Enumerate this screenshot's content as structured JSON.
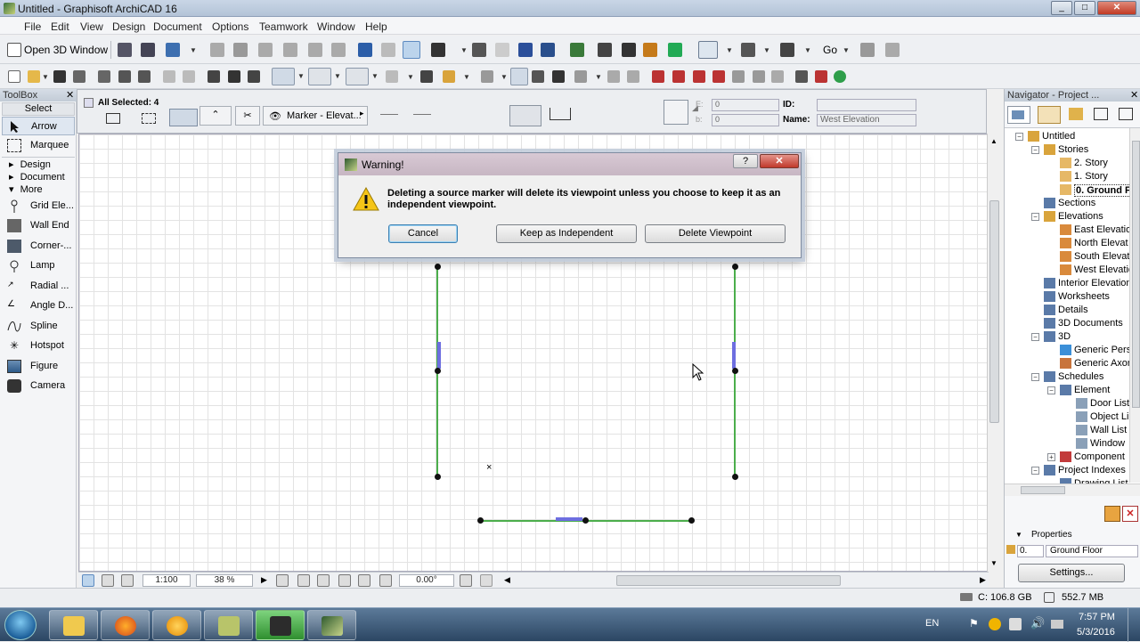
{
  "window": {
    "title": "Untitled - Graphisoft ArchiCAD 16",
    "min": "_",
    "max": "□",
    "close": "✕"
  },
  "menu": [
    "File",
    "Edit",
    "View",
    "Design",
    "Document",
    "Options",
    "Teamwork",
    "Window",
    "Help"
  ],
  "toolbar1": {
    "open3d": "Open 3D Window",
    "go": "Go"
  },
  "toolbox": {
    "title": "ToolBox",
    "close": "✕",
    "select": "Select",
    "groups": [
      "Design",
      "Document",
      "More"
    ],
    "tools": [
      {
        "label": "Arrow",
        "icon": "arrow-icon"
      },
      {
        "label": "Marquee",
        "icon": "marquee-icon"
      }
    ],
    "more_tools": [
      {
        "label": "Grid Ele...",
        "icon": "grid-element-icon"
      },
      {
        "label": "Wall End",
        "icon": "wall-end-icon"
      },
      {
        "label": "Corner-...",
        "icon": "corner-window-icon"
      },
      {
        "label": "Lamp",
        "icon": "lamp-icon"
      },
      {
        "label": "Radial ...",
        "icon": "radial-dimension-icon"
      },
      {
        "label": "Angle D...",
        "icon": "angle-dimension-icon"
      },
      {
        "label": "Spline",
        "icon": "spline-icon"
      },
      {
        "label": "Hotspot",
        "icon": "hotspot-icon"
      },
      {
        "label": "Figure",
        "icon": "figure-icon"
      },
      {
        "label": "Camera",
        "icon": "camera-icon"
      }
    ]
  },
  "infobox": {
    "selected": "All Selected: 4",
    "marker": "Marker - Elevat...",
    "e_label": "E:",
    "e_value": "0",
    "b_label": "b:",
    "b_value": "0",
    "id_label": "ID:",
    "id_value": "",
    "name_label": "Name:",
    "name_value": "West Elevation"
  },
  "dialog": {
    "title": "Warning!",
    "help": "?",
    "close": "✕",
    "message": "Deleting a source marker will delete its viewpoint unless you choose to keep it as an independent viewpoint.",
    "buttons": {
      "cancel": "Cancel",
      "keep": "Keep as Independent",
      "delete": "Delete Viewpoint"
    }
  },
  "statusbar": {
    "scale": "1:100",
    "zoom": "38 %",
    "angle": "0.00°"
  },
  "navigator": {
    "title": "Navigator - Project ...",
    "close": "✕",
    "tree": [
      {
        "label": "Untitled",
        "level": 0,
        "exp": "-"
      },
      {
        "label": "Stories",
        "level": 1,
        "exp": "-"
      },
      {
        "label": "2. Story",
        "level": 2
      },
      {
        "label": "1. Story",
        "level": 2
      },
      {
        "label": "0. Ground F",
        "level": 2,
        "selected": true
      },
      {
        "label": "Sections",
        "level": 1
      },
      {
        "label": "Elevations",
        "level": 1,
        "exp": "-"
      },
      {
        "label": "East Elevatio",
        "level": 2
      },
      {
        "label": "North Elevat",
        "level": 2
      },
      {
        "label": "South Elevat",
        "level": 2
      },
      {
        "label": "West Elevatio",
        "level": 2
      },
      {
        "label": "Interior Elevation",
        "level": 1
      },
      {
        "label": "Worksheets",
        "level": 1
      },
      {
        "label": "Details",
        "level": 1
      },
      {
        "label": "3D Documents",
        "level": 1
      },
      {
        "label": "3D",
        "level": 1,
        "exp": "-"
      },
      {
        "label": "Generic Pers",
        "level": 2
      },
      {
        "label": "Generic Axor",
        "level": 2
      },
      {
        "label": "Schedules",
        "level": 1,
        "exp": "-"
      },
      {
        "label": "Element",
        "level": 2,
        "exp": "-"
      },
      {
        "label": "Door List",
        "level": 3
      },
      {
        "label": "Object Li",
        "level": 3
      },
      {
        "label": "Wall List",
        "level": 3
      },
      {
        "label": "Window",
        "level": 3
      },
      {
        "label": "Component",
        "level": 2,
        "exp": "+"
      },
      {
        "label": "Project Indexes",
        "level": 1,
        "exp": "-"
      },
      {
        "label": "Drawing List",
        "level": 2
      }
    ],
    "properties_label": "Properties",
    "prop_num": "0.",
    "prop_value": "Ground Floor",
    "settings": "Settings..."
  },
  "bottom": {
    "disk": "C: 106.8 GB",
    "memory": "552.7 MB"
  },
  "taskbar": {
    "lang": "EN",
    "time": "7:57 PM",
    "date": "5/3/2016",
    "apps": [
      "start-orb",
      "explorer-icon",
      "firefox-icon",
      "media-icon",
      "archicad-plan-icon",
      "camtasia-icon",
      "archicad-icon"
    ]
  },
  "colors": {
    "wall_green": "#4cae4c",
    "grid": "#e3e3e3",
    "accent": "#3c7fb1"
  }
}
